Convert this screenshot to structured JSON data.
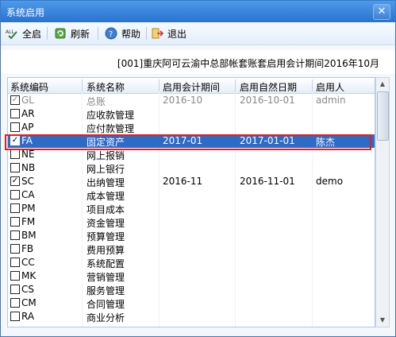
{
  "window": {
    "title": "系统启用",
    "close_glyph": "✕"
  },
  "toolbar": {
    "select_all_label": "全启",
    "refresh_label": "刷新",
    "help_label": "帮助",
    "exit_label": "退出"
  },
  "info_text": "[001]重庆阿可云渝中总部帐套账套启用会计期间2016年10月",
  "table": {
    "headers": [
      "系统编码",
      "系统名称",
      "启用会计期间",
      "启用自然日期",
      "启用人"
    ],
    "rows": [
      {
        "checked": "✓",
        "code": "GL",
        "name": "总账",
        "period": "2016-10",
        "date": "2016-10-01",
        "user": "admin"
      },
      {
        "checked": "",
        "code": "AR",
        "name": "应收款管理",
        "period": "",
        "date": "",
        "user": ""
      },
      {
        "checked": "",
        "code": "AP",
        "name": "应付款管理",
        "period": "",
        "date": "",
        "user": ""
      },
      {
        "checked": "✓",
        "code": "FA",
        "name": "固定资产",
        "period": "2017-01",
        "date": "2017-01-01",
        "user": "陈杰"
      },
      {
        "checked": "",
        "code": "NE",
        "name": "网上报销",
        "period": "",
        "date": "",
        "user": ""
      },
      {
        "checked": "",
        "code": "NB",
        "name": "网上银行",
        "period": "",
        "date": "",
        "user": ""
      },
      {
        "checked": "✓",
        "code": "SC",
        "name": "出纳管理",
        "period": "2016-11",
        "date": "2016-11-01",
        "user": "demo"
      },
      {
        "checked": "",
        "code": "CA",
        "name": "成本管理",
        "period": "",
        "date": "",
        "user": ""
      },
      {
        "checked": "",
        "code": "PM",
        "name": "项目成本",
        "period": "",
        "date": "",
        "user": ""
      },
      {
        "checked": "",
        "code": "FM",
        "name": "资金管理",
        "period": "",
        "date": "",
        "user": ""
      },
      {
        "checked": "",
        "code": "BM",
        "name": "预算管理",
        "period": "",
        "date": "",
        "user": ""
      },
      {
        "checked": "",
        "code": "FB",
        "name": "费用预算",
        "period": "",
        "date": "",
        "user": ""
      },
      {
        "checked": "",
        "code": "CC",
        "name": "系统配置",
        "period": "",
        "date": "",
        "user": ""
      },
      {
        "checked": "",
        "code": "MK",
        "name": "营销管理",
        "period": "",
        "date": "",
        "user": ""
      },
      {
        "checked": "",
        "code": "CS",
        "name": "服务管理",
        "period": "",
        "date": "",
        "user": ""
      },
      {
        "checked": "",
        "code": "CM",
        "name": "合同管理",
        "period": "",
        "date": "",
        "user": ""
      },
      {
        "checked": "",
        "code": "RA",
        "name": "商业分析",
        "period": "",
        "date": "",
        "user": ""
      }
    ]
  }
}
